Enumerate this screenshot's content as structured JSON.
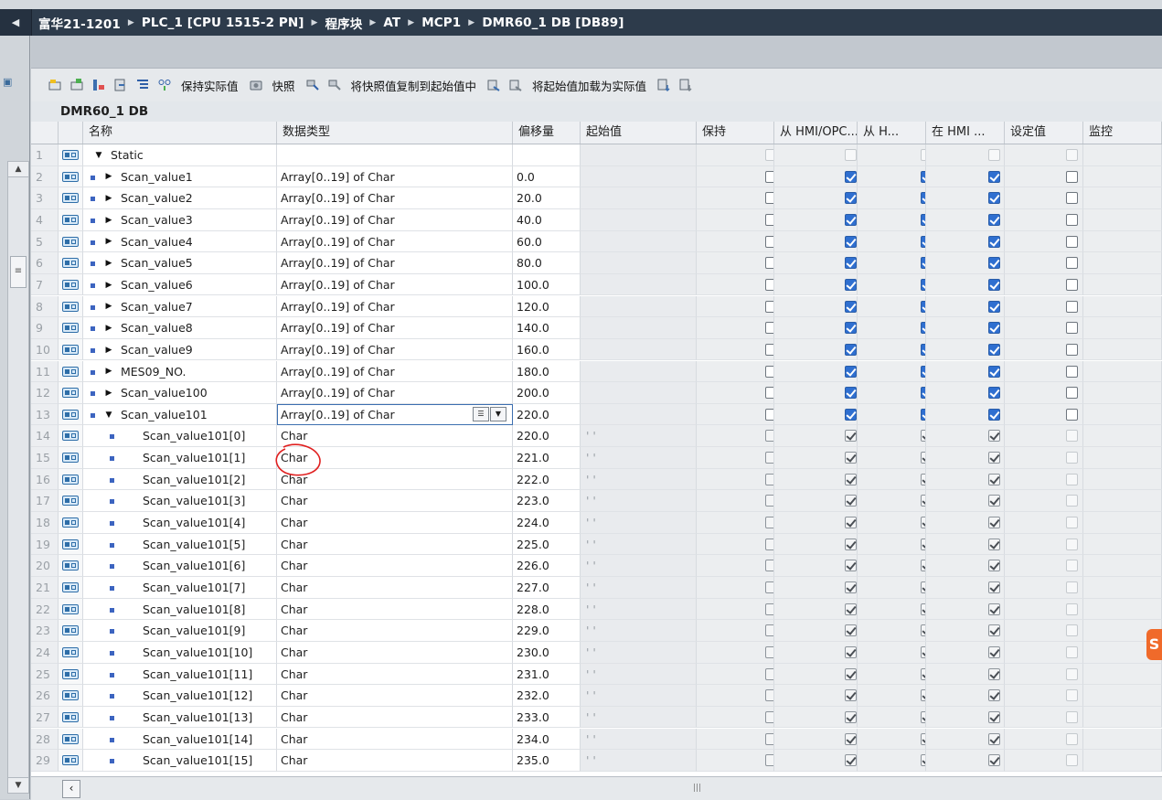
{
  "breadcrumb": [
    "富华21-1201",
    "PLC_1 [CPU 1515-2 PN]",
    "程序块",
    "AT",
    "MCP1",
    "DMR60_1 DB [DB89]"
  ],
  "toolbar": {
    "keep_actual": "保持实际值",
    "snapshot": "快照",
    "copy_snapshot": "将快照值复制到起始值中",
    "load_start": "将起始值加载为实际值"
  },
  "db_title": "DMR60_1 DB",
  "columns": [
    "名称",
    "数据类型",
    "偏移量",
    "起始值",
    "保持",
    "从 HMI/OPC...",
    "从 H...",
    "在 HMI ...",
    "设定值",
    "监控"
  ],
  "rows": [
    {
      "n": "1",
      "name": "Static",
      "type": "",
      "offset": "",
      "start": "",
      "kind": "section",
      "ret": "faint",
      "h1": "faint",
      "h2": "faint",
      "h3": "faint",
      "sp": "faint"
    },
    {
      "n": "2",
      "name": "Scan_value1",
      "type": "Array[0..19] of Char",
      "offset": "0.0",
      "start": "",
      "kind": "array",
      "ret": "off",
      "h1": "on",
      "h2": "on",
      "h3": "on",
      "sp": "off"
    },
    {
      "n": "3",
      "name": "Scan_value2",
      "type": "Array[0..19] of Char",
      "offset": "20.0",
      "start": "",
      "kind": "array",
      "ret": "off",
      "h1": "on",
      "h2": "on",
      "h3": "on",
      "sp": "off"
    },
    {
      "n": "4",
      "name": "Scan_value3",
      "type": "Array[0..19] of Char",
      "offset": "40.0",
      "start": "",
      "kind": "array",
      "ret": "off",
      "h1": "on",
      "h2": "on",
      "h3": "on",
      "sp": "off"
    },
    {
      "n": "5",
      "name": "Scan_value4",
      "type": "Array[0..19] of Char",
      "offset": "60.0",
      "start": "",
      "kind": "array",
      "ret": "off",
      "h1": "on",
      "h2": "on",
      "h3": "on",
      "sp": "off"
    },
    {
      "n": "6",
      "name": "Scan_value5",
      "type": "Array[0..19] of Char",
      "offset": "80.0",
      "start": "",
      "kind": "array",
      "ret": "off",
      "h1": "on",
      "h2": "on",
      "h3": "on",
      "sp": "off"
    },
    {
      "n": "7",
      "name": "Scan_value6",
      "type": "Array[0..19] of Char",
      "offset": "100.0",
      "start": "",
      "kind": "array",
      "ret": "off",
      "h1": "on",
      "h2": "on",
      "h3": "on",
      "sp": "off"
    },
    {
      "n": "8",
      "name": "Scan_value7",
      "type": "Array[0..19] of Char",
      "offset": "120.0",
      "start": "",
      "kind": "array",
      "ret": "off",
      "h1": "on",
      "h2": "on",
      "h3": "on",
      "sp": "off"
    },
    {
      "n": "9",
      "name": "Scan_value8",
      "type": "Array[0..19] of Char",
      "offset": "140.0",
      "start": "",
      "kind": "array",
      "ret": "off",
      "h1": "on",
      "h2": "on",
      "h3": "on",
      "sp": "off"
    },
    {
      "n": "10",
      "name": "Scan_value9",
      "type": "Array[0..19] of Char",
      "offset": "160.0",
      "start": "",
      "kind": "array",
      "ret": "off",
      "h1": "on",
      "h2": "on",
      "h3": "on",
      "sp": "off"
    },
    {
      "n": "11",
      "name": "MES09_NO.",
      "type": "Array[0..19] of Char",
      "offset": "180.0",
      "start": "",
      "kind": "array",
      "ret": "off",
      "h1": "on",
      "h2": "on",
      "h3": "on",
      "sp": "off"
    },
    {
      "n": "12",
      "name": "Scan_value100",
      "type": "Array[0..19] of Char",
      "offset": "200.0",
      "start": "",
      "kind": "array",
      "ret": "off",
      "h1": "on",
      "h2": "on",
      "h3": "on",
      "sp": "off"
    },
    {
      "n": "13",
      "name": "Scan_value101",
      "type": "Array[0..19] of Char",
      "offset": "220.0",
      "start": "",
      "kind": "array-open",
      "ret": "off",
      "h1": "on",
      "h2": "on",
      "h3": "on",
      "sp": "off"
    },
    {
      "n": "14",
      "name": "Scan_value101[0]",
      "type": "Char",
      "offset": "220.0",
      "start": "' '",
      "kind": "elem",
      "ret": "dimoff",
      "h1": "dimon",
      "h2": "dimon",
      "h3": "dimon",
      "sp": "faint"
    },
    {
      "n": "15",
      "name": "Scan_value101[1]",
      "type": "Char",
      "offset": "221.0",
      "start": "' '",
      "kind": "elem",
      "ret": "dimoff",
      "h1": "dimon",
      "h2": "dimon",
      "h3": "dimon",
      "sp": "faint"
    },
    {
      "n": "16",
      "name": "Scan_value101[2]",
      "type": "Char",
      "offset": "222.0",
      "start": "' '",
      "kind": "elem",
      "ret": "dimoff",
      "h1": "dimon",
      "h2": "dimon",
      "h3": "dimon",
      "sp": "faint"
    },
    {
      "n": "17",
      "name": "Scan_value101[3]",
      "type": "Char",
      "offset": "223.0",
      "start": "' '",
      "kind": "elem",
      "ret": "dimoff",
      "h1": "dimon",
      "h2": "dimon",
      "h3": "dimon",
      "sp": "faint"
    },
    {
      "n": "18",
      "name": "Scan_value101[4]",
      "type": "Char",
      "offset": "224.0",
      "start": "' '",
      "kind": "elem",
      "ret": "dimoff",
      "h1": "dimon",
      "h2": "dimon",
      "h3": "dimon",
      "sp": "faint"
    },
    {
      "n": "19",
      "name": "Scan_value101[5]",
      "type": "Char",
      "offset": "225.0",
      "start": "' '",
      "kind": "elem",
      "ret": "dimoff",
      "h1": "dimon",
      "h2": "dimon",
      "h3": "dimon",
      "sp": "faint"
    },
    {
      "n": "20",
      "name": "Scan_value101[6]",
      "type": "Char",
      "offset": "226.0",
      "start": "' '",
      "kind": "elem",
      "ret": "dimoff",
      "h1": "dimon",
      "h2": "dimon",
      "h3": "dimon",
      "sp": "faint"
    },
    {
      "n": "21",
      "name": "Scan_value101[7]",
      "type": "Char",
      "offset": "227.0",
      "start": "' '",
      "kind": "elem",
      "ret": "dimoff",
      "h1": "dimon",
      "h2": "dimon",
      "h3": "dimon",
      "sp": "faint"
    },
    {
      "n": "22",
      "name": "Scan_value101[8]",
      "type": "Char",
      "offset": "228.0",
      "start": "' '",
      "kind": "elem",
      "ret": "dimoff",
      "h1": "dimon",
      "h2": "dimon",
      "h3": "dimon",
      "sp": "faint"
    },
    {
      "n": "23",
      "name": "Scan_value101[9]",
      "type": "Char",
      "offset": "229.0",
      "start": "' '",
      "kind": "elem",
      "ret": "dimoff",
      "h1": "dimon",
      "h2": "dimon",
      "h3": "dimon",
      "sp": "faint"
    },
    {
      "n": "24",
      "name": "Scan_value101[10]",
      "type": "Char",
      "offset": "230.0",
      "start": "' '",
      "kind": "elem",
      "ret": "dimoff",
      "h1": "dimon",
      "h2": "dimon",
      "h3": "dimon",
      "sp": "faint"
    },
    {
      "n": "25",
      "name": "Scan_value101[11]",
      "type": "Char",
      "offset": "231.0",
      "start": "' '",
      "kind": "elem",
      "ret": "dimoff",
      "h1": "dimon",
      "h2": "dimon",
      "h3": "dimon",
      "sp": "faint"
    },
    {
      "n": "26",
      "name": "Scan_value101[12]",
      "type": "Char",
      "offset": "232.0",
      "start": "' '",
      "kind": "elem",
      "ret": "dimoff",
      "h1": "dimon",
      "h2": "dimon",
      "h3": "dimon",
      "sp": "faint"
    },
    {
      "n": "27",
      "name": "Scan_value101[13]",
      "type": "Char",
      "offset": "233.0",
      "start": "' '",
      "kind": "elem",
      "ret": "dimoff",
      "h1": "dimon",
      "h2": "dimon",
      "h3": "dimon",
      "sp": "faint"
    },
    {
      "n": "28",
      "name": "Scan_value101[14]",
      "type": "Char",
      "offset": "234.0",
      "start": "' '",
      "kind": "elem",
      "ret": "dimoff",
      "h1": "dimon",
      "h2": "dimon",
      "h3": "dimon",
      "sp": "faint"
    },
    {
      "n": "29",
      "name": "Scan_value101[15]",
      "type": "Char",
      "offset": "235.0",
      "start": "' '",
      "kind": "elem",
      "ret": "dimoff",
      "h1": "dimon",
      "h2": "dimon",
      "h3": "dimon",
      "sp": "faint"
    }
  ],
  "colors": {
    "title_bar": "#2d3b4b",
    "checkbox_on": "#2f6fd0",
    "selection": "#3c6fb0",
    "annotation": "#e02020"
  },
  "icons": {
    "back": "chevron-left-icon",
    "breadcrumb_sep": "triangle-right-icon",
    "db_interface": "db-interface-icon",
    "expand": "expand-triangle-icon"
  }
}
